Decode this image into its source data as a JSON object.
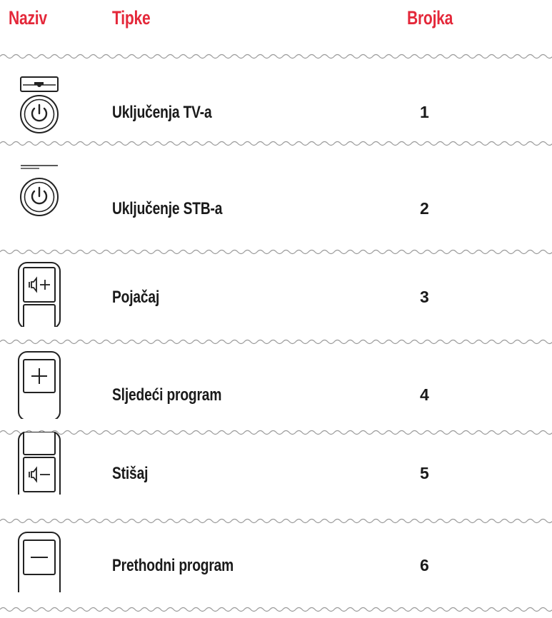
{
  "header": {
    "col_name": "Naziv",
    "col_buttons": "Tipke",
    "col_number": "Brojka"
  },
  "colors": {
    "accent": "#e4283a",
    "text": "#1a1a1a",
    "divider": "#9a9a9a"
  },
  "rows": [
    {
      "icon": "power-tv-icon",
      "label": "Uključenja TV-a",
      "number": "1"
    },
    {
      "icon": "power-stb-icon",
      "label": "Uključenje STB-a",
      "number": "2"
    },
    {
      "icon": "volume-up-icon",
      "label": "Pojačaj",
      "number": "3"
    },
    {
      "icon": "channel-plus-icon",
      "label": "Sljedeći program",
      "number": "4"
    },
    {
      "icon": "volume-down-icon",
      "label": "Stišaj",
      "number": "5"
    },
    {
      "icon": "channel-minus-icon",
      "label": "Prethodni program",
      "number": "6"
    }
  ]
}
